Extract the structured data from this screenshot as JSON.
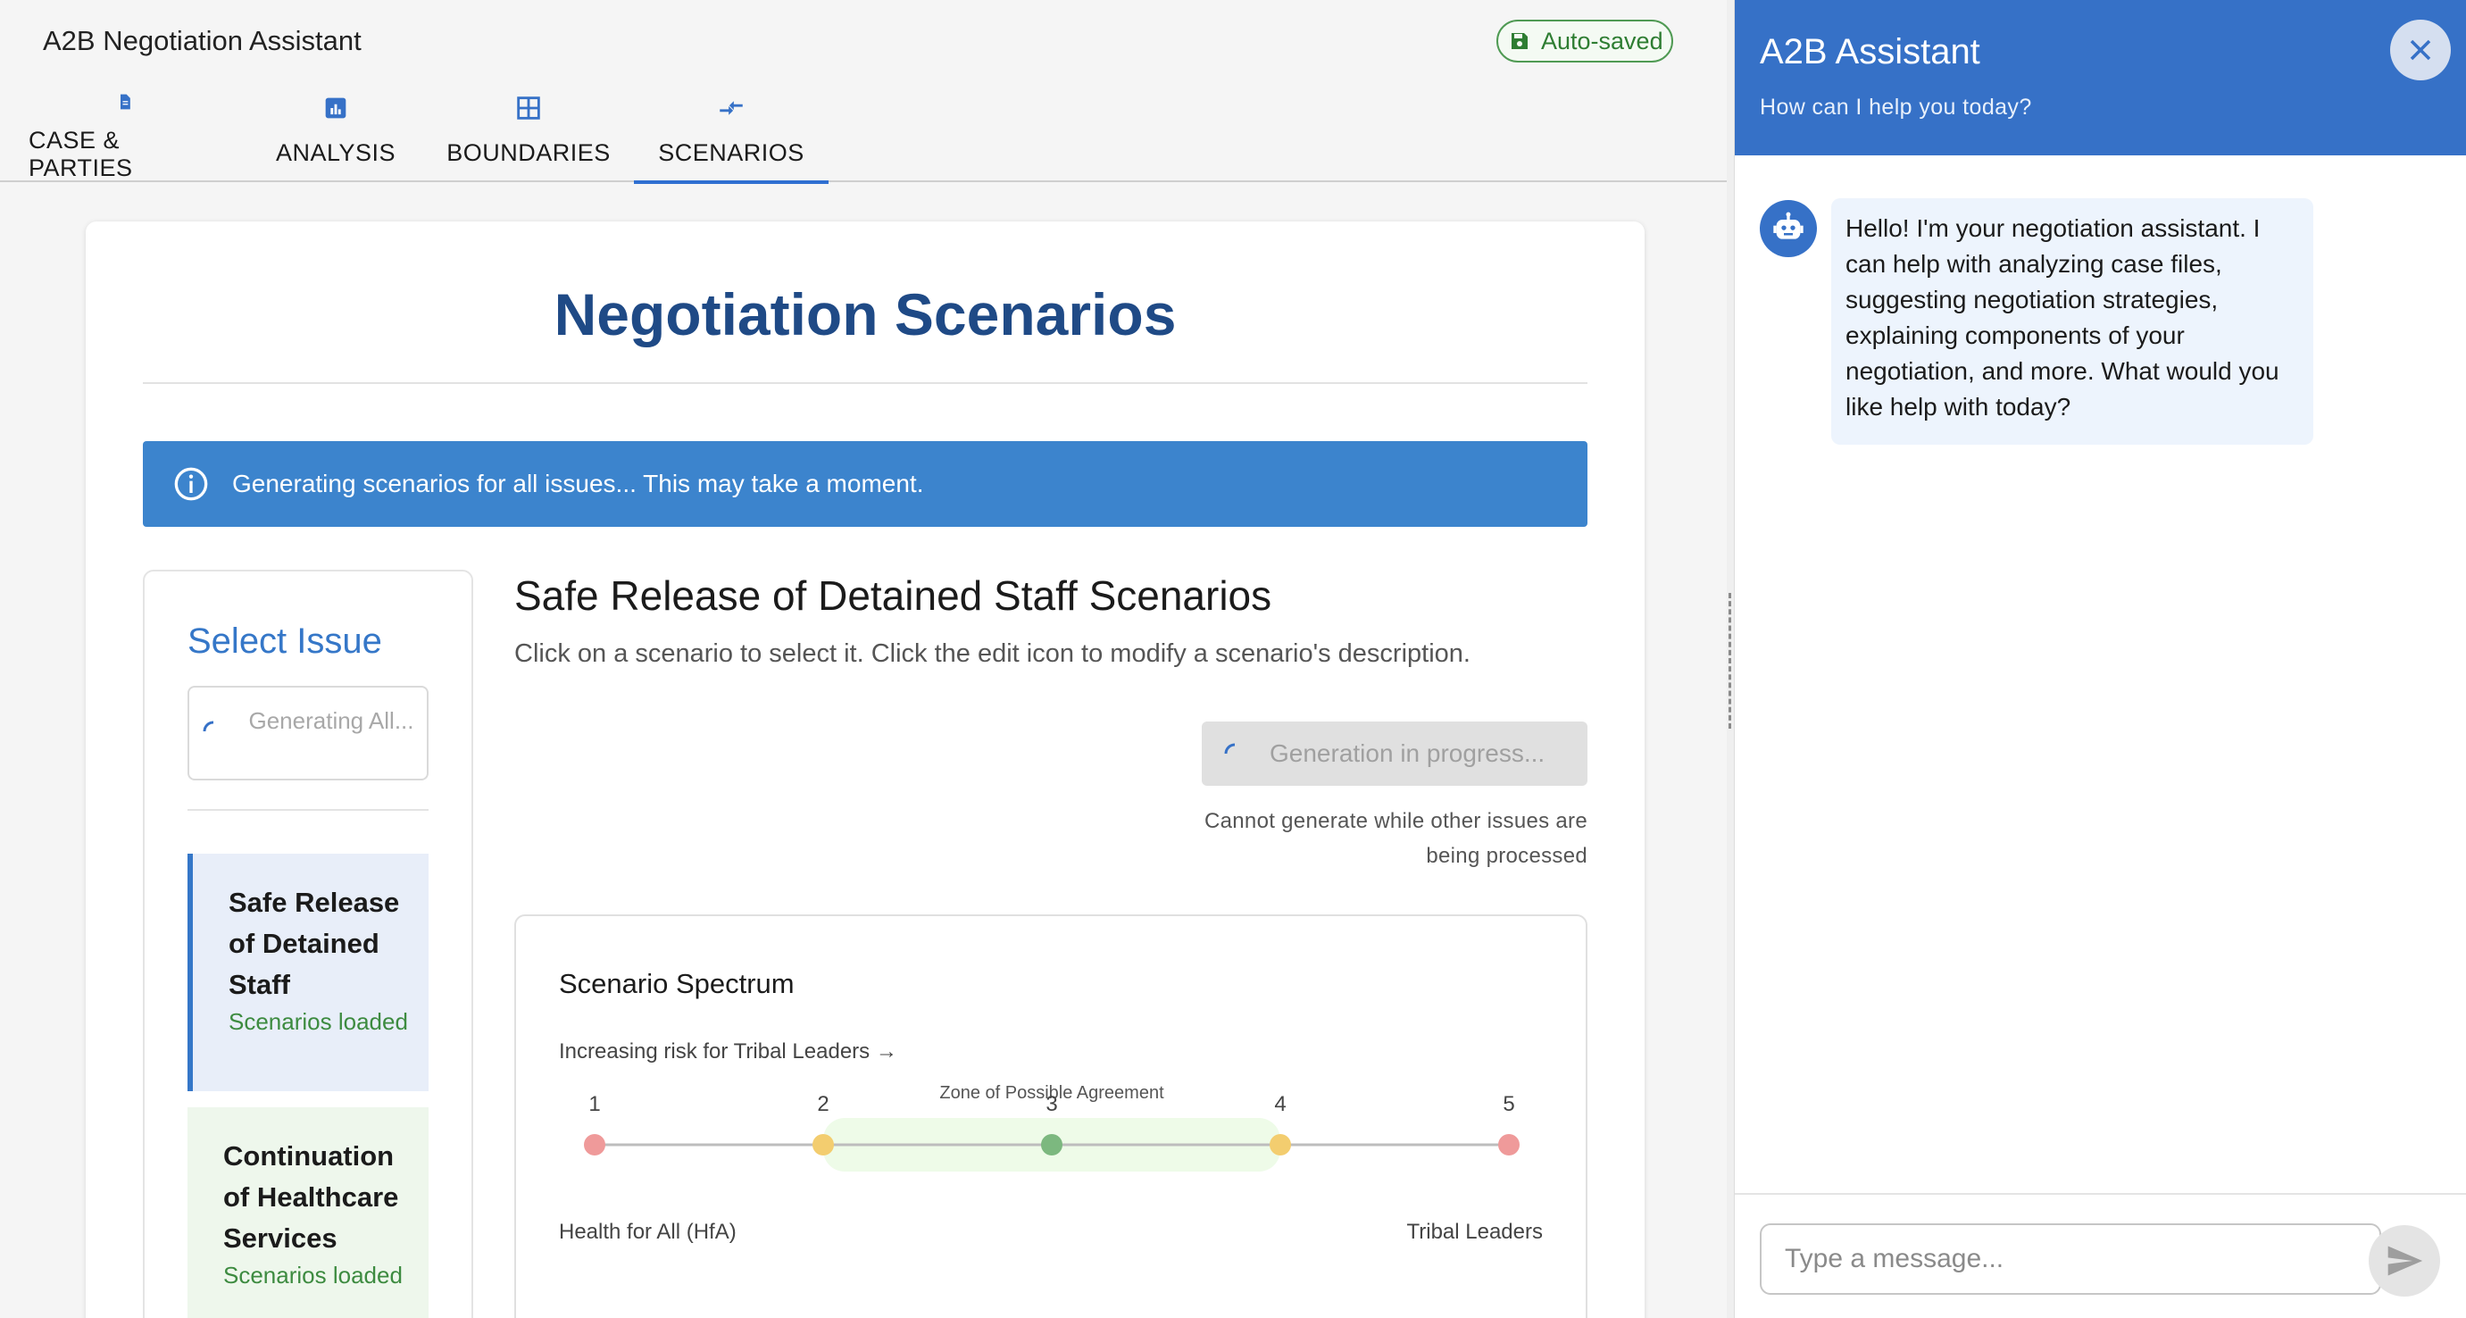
{
  "app": {
    "title": "A2B Negotiation Assistant",
    "autosave_label": "Auto-saved",
    "accent": "#2f6fd1"
  },
  "tabs": [
    {
      "label": "CASE & PARTIES",
      "icon": "document-icon",
      "active": false
    },
    {
      "label": "ANALYSIS",
      "icon": "bar-chart-icon",
      "active": false
    },
    {
      "label": "BOUNDARIES",
      "icon": "grid-icon",
      "active": false
    },
    {
      "label": "SCENARIOS",
      "icon": "compare-arrows-icon",
      "active": true
    }
  ],
  "page": {
    "title": "Negotiation Scenarios",
    "info_banner": "Generating scenarios for all issues... This may take a moment."
  },
  "sidebar": {
    "title": "Select Issue",
    "generate_all_label": "Generating All...",
    "issues": [
      {
        "title": "Safe Release of Detained Staff",
        "status": "Scenarios loaded",
        "selected": true
      },
      {
        "title": "Continuation of Healthcare Services",
        "status": "Scenarios loaded",
        "selected": false
      }
    ]
  },
  "main": {
    "title": "Safe Release of Detained Staff Scenarios",
    "subtitle": "Click on a scenario to select it. Click the edit icon to modify a scenario's description.",
    "generate_button_label": "Generation in progress...",
    "cannot_generate_note": "Cannot generate while other issues are being processed"
  },
  "spectrum": {
    "title": "Scenario Spectrum",
    "risk_label": "Increasing risk for Tribal Leaders →",
    "zone_label": "Zone of Possible Agreement",
    "left_party": "Health for All (HfA)",
    "right_party": "Tribal Leaders",
    "points": [
      {
        "label": "1",
        "color": "#ef9a9a"
      },
      {
        "label": "2",
        "color": "#f3cd6f"
      },
      {
        "label": "3",
        "color": "#7cb87f"
      },
      {
        "label": "4",
        "color": "#f3cd6f"
      },
      {
        "label": "5",
        "color": "#ef9a9a"
      }
    ],
    "zone_range": [
      2,
      4
    ]
  },
  "chat": {
    "title": "A2B Assistant",
    "subtitle": "How can I help you today?",
    "messages": [
      {
        "role": "assistant",
        "text": "Hello! I'm your negotiation assistant. I can help with analyzing case files, suggesting negotiation strategies, explaining components of your negotiation, and more. What would you like help with today?"
      }
    ],
    "input_placeholder": "Type a message..."
  }
}
